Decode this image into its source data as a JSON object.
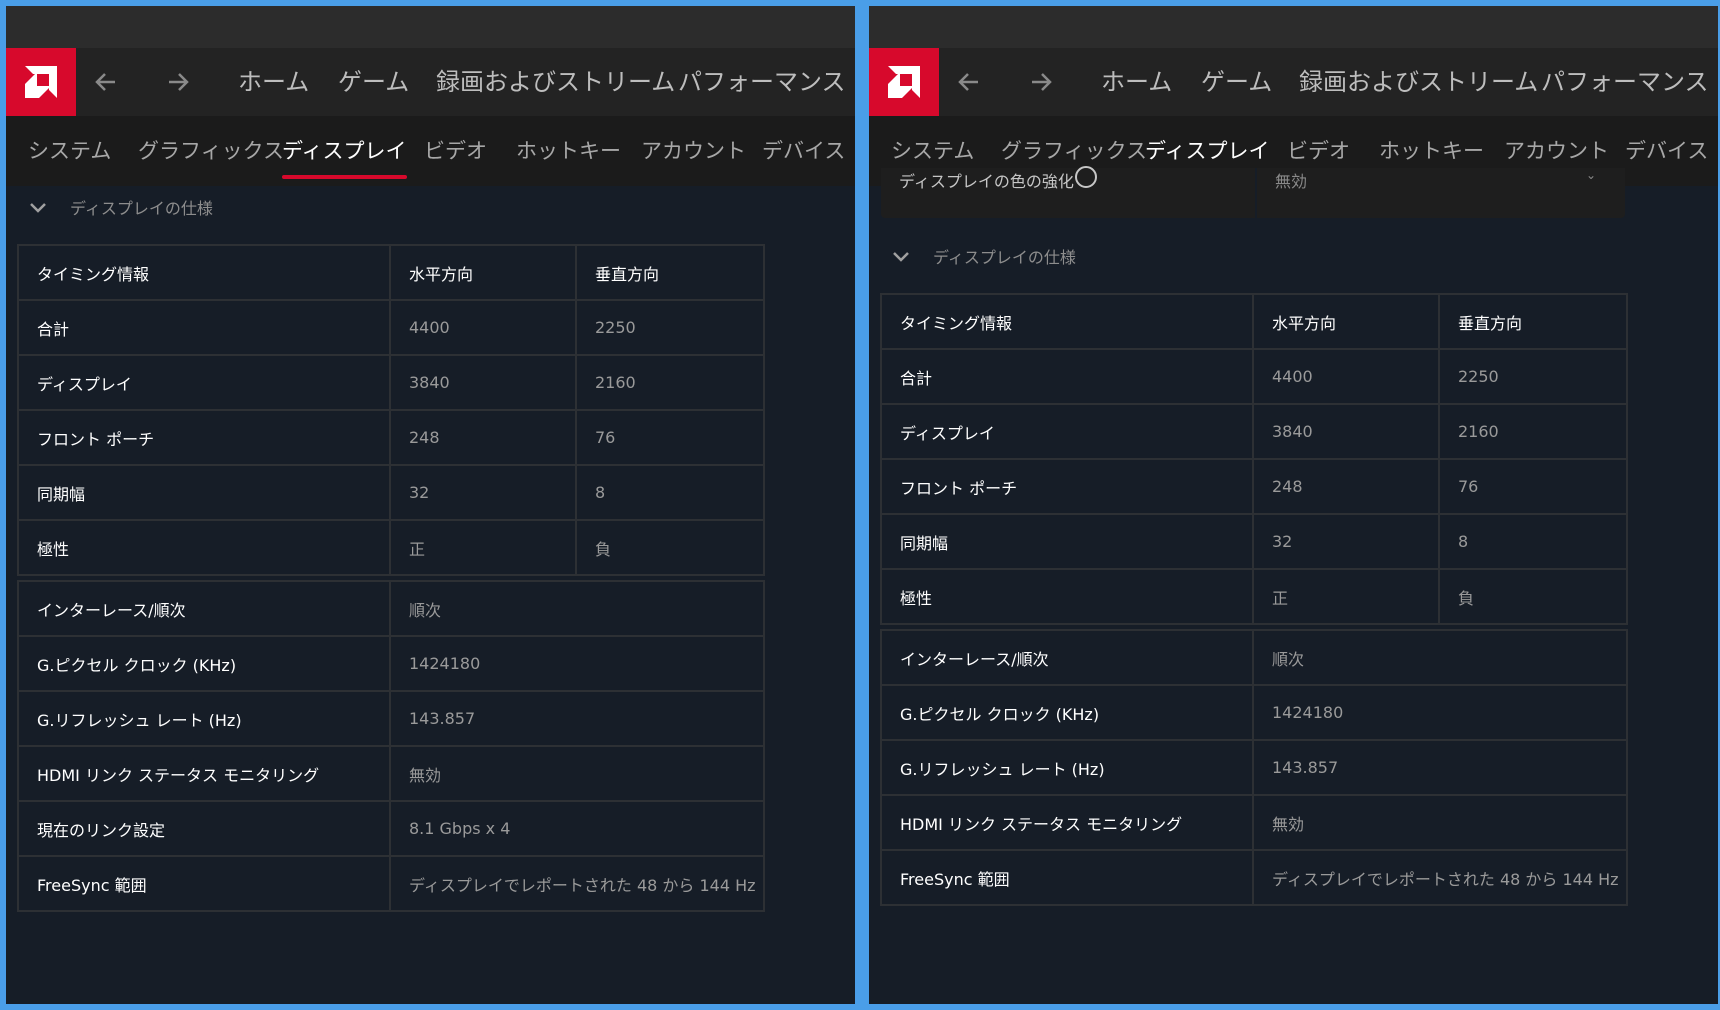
{
  "colors": {
    "accent": "#d7092c",
    "background": "#161d27",
    "frame": "#4a9ee8"
  },
  "nav": {
    "logo_icon": "amd-logo-icon",
    "back_icon": "arrow-left-icon",
    "forward_icon": "arrow-right-icon",
    "items": [
      "ホーム",
      "ゲーム",
      "録画およびストリーム",
      "パフォーマンス"
    ]
  },
  "subnav": {
    "items": [
      "システム",
      "グラフィックス",
      "ディスプレイ",
      "ビデオ",
      "ホットキー",
      "アカウント",
      "デバイス"
    ],
    "active": "ディスプレイ"
  },
  "section_title": "ディスプレイの仕様",
  "right_top_cropped": {
    "label": "ディスプレイの色の強化",
    "value": "無効"
  },
  "timing_table": {
    "headers": [
      "タイミング情報",
      "水平方向",
      "垂直方向"
    ],
    "rows": [
      [
        "合計",
        "4400",
        "2250"
      ],
      [
        "ディスプレイ",
        "3840",
        "2160"
      ],
      [
        "フロント ポーチ",
        "248",
        "76"
      ],
      [
        "同期幅",
        "32",
        "8"
      ],
      [
        "極性",
        "正",
        "負"
      ]
    ]
  },
  "info_table_left": [
    [
      "インターレース/順次",
      "順次"
    ],
    [
      "G.ピクセル クロック (KHz)",
      "1424180"
    ],
    [
      "G.リフレッシュ レート (Hz)",
      "143.857"
    ],
    [
      "HDMI リンク ステータス モニタリング",
      "無効"
    ],
    [
      "現在のリンク設定",
      "8.1 Gbps x 4"
    ],
    [
      "FreeSync 範囲",
      "ディスプレイでレポートされた 48 から 144 Hz"
    ]
  ],
  "info_table_right": [
    [
      "インターレース/順次",
      "順次"
    ],
    [
      "G.ピクセル クロック (KHz)",
      "1424180"
    ],
    [
      "G.リフレッシュ レート (Hz)",
      "143.857"
    ],
    [
      "HDMI リンク ステータス モニタリング",
      "無効"
    ],
    [
      "FreeSync 範囲",
      "ディスプレイでレポートされた 48 から 144 Hz"
    ]
  ]
}
